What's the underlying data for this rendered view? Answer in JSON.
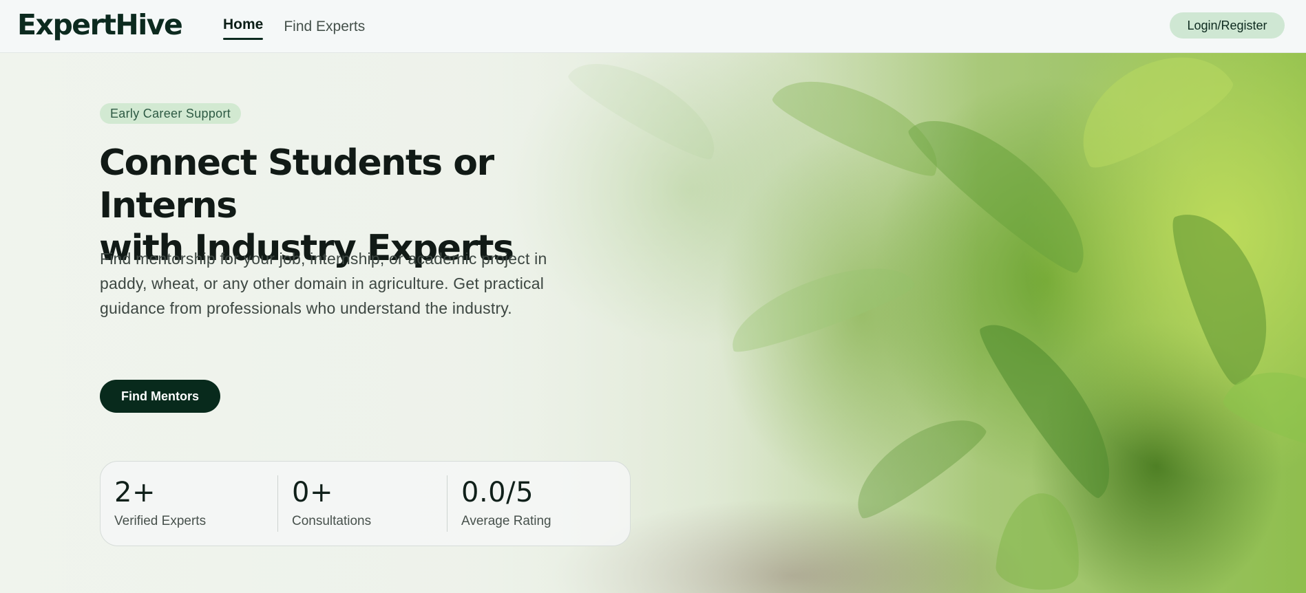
{
  "header": {
    "logo": "ExpertHive",
    "nav": [
      {
        "label": "Home",
        "active": true
      },
      {
        "label": "Find Experts",
        "active": false
      }
    ],
    "login_label": "Login/Register"
  },
  "hero": {
    "tag": "Early Career Support",
    "headline_line1": "Connect Students or Interns",
    "headline_line2": "with Industry Experts",
    "subtext": "Find mentorship for your job, internship, or academic project in paddy, wheat, or any other domain in agriculture. Get practical guidance from professionals who understand the industry.",
    "cta_label": "Find Mentors",
    "background_image": "corn-field-photo"
  },
  "stats": [
    {
      "value": "2+",
      "label": "Verified Experts"
    },
    {
      "value": "0+",
      "label": "Consultations"
    },
    {
      "value": "0.0/5",
      "label": "Average Rating"
    }
  ],
  "colors": {
    "brand_dark": "#082a1c",
    "login_bg": "#cfe7d3",
    "tag_bg": "#cde6cd"
  }
}
